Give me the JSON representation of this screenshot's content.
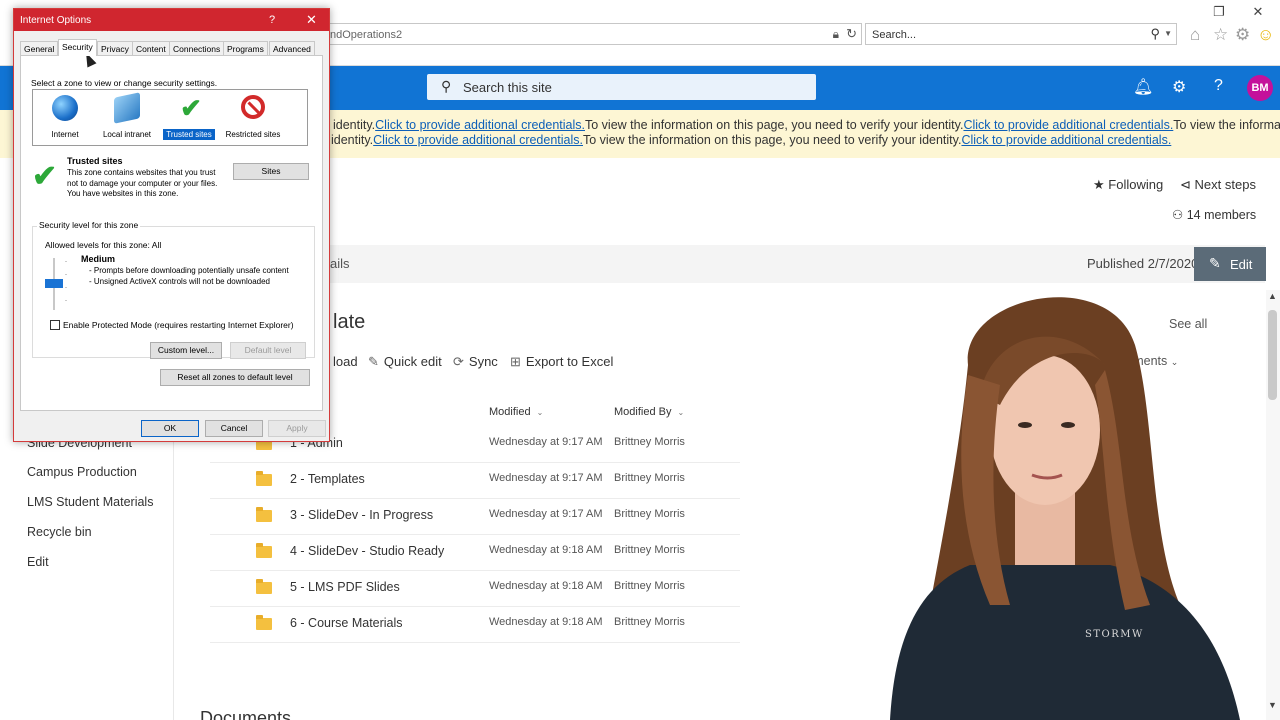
{
  "browser": {
    "address_text": "ndOperations2",
    "search_placeholder": "Search...",
    "icons": [
      "restore-window-icon",
      "close-window-icon",
      "lock-icon",
      "refresh-icon",
      "search-icon",
      "home-icon",
      "favorites-star-icon",
      "settings-gear-icon",
      "smiley-feedback-icon"
    ]
  },
  "sp_header": {
    "search_placeholder": "Search this site",
    "avatar_initials": "BM",
    "accent_color": "#1174d4",
    "avatar_color": "#c4119b"
  },
  "banner": {
    "line1": [
      {
        "type": "text",
        "text": "identity."
      },
      {
        "type": "link",
        "text": "Click to provide additional credentials."
      },
      {
        "type": "text",
        "text": "To view the information on this page, you need to verify your identity."
      },
      {
        "type": "link",
        "text": "Click to provide additional credentials."
      },
      {
        "type": "text",
        "text": "To view the information on"
      }
    ],
    "line2": [
      {
        "type": "text",
        "text": "identity."
      },
      {
        "type": "link",
        "text": "Click to provide additional credentials."
      },
      {
        "type": "text",
        "text": "To view the information on this page, you need to verify your identity."
      },
      {
        "type": "link",
        "text": "Click to provide additional credentials."
      }
    ]
  },
  "site": {
    "following": "Following",
    "next_steps": "Next steps",
    "members": "14 members",
    "cmd_tail": "ails",
    "published": "Published 2/7/2020",
    "edit": "Edit"
  },
  "library": {
    "title_tail": "late",
    "see_all": "See all",
    "commands": [
      {
        "label": "load",
        "icon": ""
      },
      {
        "label": "Quick edit",
        "icon": "✎"
      },
      {
        "label": "Sync",
        "icon": "⟳"
      },
      {
        "label": "Export to Excel",
        "icon": "⊞"
      }
    ],
    "view": "cuments",
    "columns": {
      "modified": "Modified",
      "modified_by": "Modified By"
    },
    "rows": [
      {
        "name": "1 - Admin",
        "modified": "Wednesday at 9:17 AM",
        "by": "Brittney Morris"
      },
      {
        "name": "2 - Templates",
        "modified": "Wednesday at 9:17 AM",
        "by": "Brittney Morris"
      },
      {
        "name": "3 - SlideDev - In Progress",
        "modified": "Wednesday at 9:17 AM",
        "by": "Brittney Morris"
      },
      {
        "name": "4 - SlideDev - Studio Ready",
        "modified": "Wednesday at 9:18 AM",
        "by": "Brittney Morris"
      },
      {
        "name": "5 - LMS PDF Slides",
        "modified": "Wednesday at 9:18 AM",
        "by": "Brittney Morris"
      },
      {
        "name": "6 - Course Materials",
        "modified": "Wednesday at 9:18 AM",
        "by": "Brittney Morris"
      }
    ],
    "documents_heading": "Documents"
  },
  "leftnav": {
    "items": [
      "Slide Development",
      "Campus Production",
      "LMS Student Materials",
      "Recycle bin",
      "Edit"
    ]
  },
  "dialog": {
    "title": "Internet Options",
    "help": "?",
    "close": "✕",
    "tabs": [
      "General",
      "Security",
      "Privacy",
      "Content",
      "Connections",
      "Programs",
      "Advanced"
    ],
    "active_tab": "Security",
    "zone_prompt": "Select a zone to view or change security settings.",
    "zones": [
      "Internet",
      "Local intranet",
      "Trusted sites",
      "Restricted sites"
    ],
    "selected_zone": "Trusted sites",
    "zone_title": "Trusted sites",
    "zone_desc": "This zone contains websites that you trust not to damage your computer or your files.",
    "zone_has_sites": "You have websites in this zone.",
    "sites_button": "Sites",
    "security_level_label": "Security level for this zone",
    "allowed_levels": "Allowed levels for this zone: All",
    "level_name": "Medium",
    "level_desc1": "- Prompts before downloading potentially unsafe content",
    "level_desc2": "- Unsigned ActiveX controls will not be downloaded",
    "protected_mode": "Enable Protected Mode (requires restarting Internet Explorer)",
    "custom_level": "Custom level...",
    "default_level": "Default level",
    "reset_all": "Reset all zones to default level",
    "ok": "OK",
    "cancel": "Cancel",
    "apply": "Apply",
    "title_color": "#d0262f"
  },
  "presenter": {
    "shirt_text": "STORMW"
  }
}
